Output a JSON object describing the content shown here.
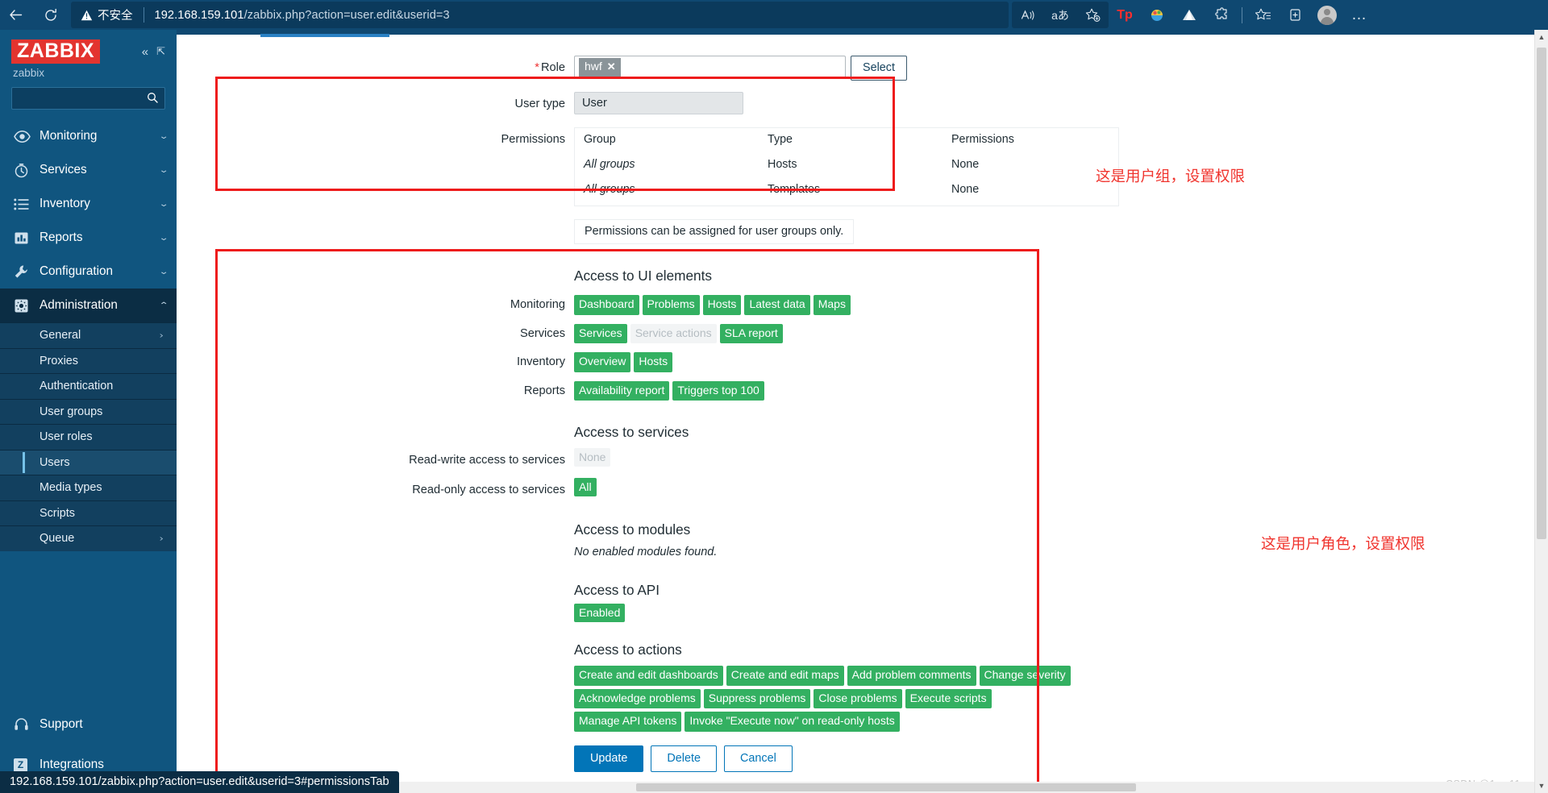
{
  "browser": {
    "back_icon": "back-arrow-icon",
    "reload_icon": "reload-icon",
    "security_label": "不安全",
    "url_host": "192.168.159.101",
    "url_path": "/zabbix.php?action=user.edit&userid=3",
    "toolbar_icons": [
      {
        "name": "read-aloud-icon",
        "glyph": "A"
      },
      {
        "name": "translate-icon",
        "glyph": "aあ"
      },
      {
        "name": "add-favorite-icon",
        "glyph": "☆"
      },
      {
        "name": "tp-extension-icon",
        "glyph": "Tp"
      },
      {
        "name": "colorful-extension-icon",
        "glyph": "◍"
      },
      {
        "name": "mountain-extension-icon",
        "glyph": "▲"
      },
      {
        "name": "puzzle-extensions-icon",
        "glyph": "❏"
      },
      {
        "name": "favorites-icon",
        "glyph": "☆"
      },
      {
        "name": "collections-icon",
        "glyph": "⊞"
      },
      {
        "name": "profile-avatar",
        "glyph": ""
      },
      {
        "name": "settings-more-icon",
        "glyph": "…"
      }
    ]
  },
  "sidebar": {
    "logo_text": "ZABBIX",
    "server_name": "zabbix",
    "collapse_icon": "collapse-sidebar-icon",
    "hide_icon": "hide-sidebar-icon",
    "search_placeholder": "",
    "search_value": "",
    "search_icon": "search-icon",
    "items": [
      {
        "label": "Monitoring",
        "icon": "eye-icon",
        "chevron": "⌄"
      },
      {
        "label": "Services",
        "icon": "clock-icon",
        "chevron": "⌄"
      },
      {
        "label": "Inventory",
        "icon": "list-icon",
        "chevron": "⌄"
      },
      {
        "label": "Reports",
        "icon": "bar-chart-icon",
        "chevron": "⌄"
      },
      {
        "label": "Configuration",
        "icon": "wrench-icon",
        "chevron": "⌄"
      },
      {
        "label": "Administration",
        "icon": "gear-icon",
        "chevron": "⌃"
      }
    ],
    "sub_items": [
      {
        "label": "General",
        "chevron": "›",
        "selected": false
      },
      {
        "label": "Proxies",
        "chevron": "",
        "selected": false
      },
      {
        "label": "Authentication",
        "chevron": "",
        "selected": false
      },
      {
        "label": "User groups",
        "chevron": "",
        "selected": false
      },
      {
        "label": "User roles",
        "chevron": "",
        "selected": false
      },
      {
        "label": "Users",
        "chevron": "",
        "selected": true
      },
      {
        "label": "Media types",
        "chevron": "",
        "selected": false
      },
      {
        "label": "Scripts",
        "chevron": "",
        "selected": false
      },
      {
        "label": "Queue",
        "chevron": "›",
        "selected": false
      }
    ],
    "footer_items": [
      {
        "label": "Support",
        "icon": "headset-icon"
      },
      {
        "label": "Integrations",
        "icon": "zabbix-z-icon"
      }
    ]
  },
  "form": {
    "role": {
      "label": "Role",
      "required_marker": "*",
      "chip_value": "hwf",
      "chip_remove_icon": "✕",
      "select_button": "Select"
    },
    "user_type": {
      "label": "User type",
      "value": "User"
    },
    "permissions": {
      "label": "Permissions",
      "headers": [
        "Group",
        "Type",
        "Permissions"
      ],
      "rows": [
        {
          "group": "All groups",
          "type": "Hosts",
          "permission": "None"
        },
        {
          "group": "All groups",
          "type": "Templates",
          "permission": "None"
        }
      ],
      "note": "Permissions can be assigned for user groups only."
    },
    "ui_elements": {
      "title": "Access to UI elements",
      "groups": [
        {
          "label": "Monitoring",
          "tags": [
            {
              "text": "Dashboard",
              "enabled": true
            },
            {
              "text": "Problems",
              "enabled": true
            },
            {
              "text": "Hosts",
              "enabled": true
            },
            {
              "text": "Latest data",
              "enabled": true
            },
            {
              "text": "Maps",
              "enabled": true
            }
          ]
        },
        {
          "label": "Services",
          "tags": [
            {
              "text": "Services",
              "enabled": true
            },
            {
              "text": "Service actions",
              "enabled": false
            },
            {
              "text": "SLA report",
              "enabled": true
            }
          ]
        },
        {
          "label": "Inventory",
          "tags": [
            {
              "text": "Overview",
              "enabled": true
            },
            {
              "text": "Hosts",
              "enabled": true
            }
          ]
        },
        {
          "label": "Reports",
          "tags": [
            {
              "text": "Availability report",
              "enabled": true
            },
            {
              "text": "Triggers top 100",
              "enabled": true
            }
          ]
        }
      ]
    },
    "services_access": {
      "title": "Access to services",
      "read_write_label": "Read-write access to services",
      "read_write_value": "None",
      "read_write_enabled": false,
      "read_only_label": "Read-only access to services",
      "read_only_value": "All",
      "read_only_enabled": true
    },
    "modules_access": {
      "title": "Access to modules",
      "note": "No enabled modules found."
    },
    "api_access": {
      "title": "Access to API",
      "tag": "Enabled"
    },
    "actions_access": {
      "title": "Access to actions",
      "rows": [
        [
          "Create and edit dashboards",
          "Create and edit maps",
          "Add problem comments",
          "Change severity"
        ],
        [
          "Acknowledge problems",
          "Suppress problems",
          "Close problems",
          "Execute scripts"
        ],
        [
          "Manage API tokens",
          "Invoke \"Execute now\" on read-only hosts"
        ]
      ]
    },
    "buttons": {
      "update": "Update",
      "delete": "Delete",
      "cancel": "Cancel"
    }
  },
  "annotations": [
    {
      "text": "这是用户组，设置权限"
    },
    {
      "text": "这是用户角色，设置权限"
    }
  ],
  "statusbar": {
    "text": "192.168.159.101/zabbix.php?action=user.edit&userid=3#permissionsTab"
  },
  "watermark": {
    "text": "CSDN @1we11"
  },
  "colors": {
    "zabbix_red": "#e3342f",
    "sidebar_blue": "#10557f",
    "tag_green": "#33b061",
    "primary_blue": "#0275b8",
    "annotation_red": "#f0342e"
  }
}
